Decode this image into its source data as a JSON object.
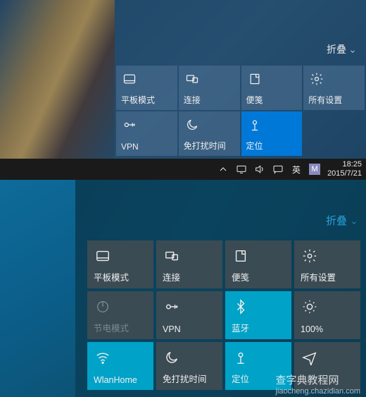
{
  "top": {
    "collapse_label": "折叠",
    "tiles": [
      {
        "name": "tablet-mode",
        "label": "平板模式",
        "icon": "tablet",
        "active": false
      },
      {
        "name": "connect",
        "label": "连接",
        "icon": "connect",
        "active": false
      },
      {
        "name": "note",
        "label": "便笺",
        "icon": "note",
        "active": false
      },
      {
        "name": "all-settings",
        "label": "所有设置",
        "icon": "gear",
        "active": false
      },
      {
        "name": "vpn",
        "label": "VPN",
        "icon": "vpn",
        "active": false
      },
      {
        "name": "quiet-hours",
        "label": "免打扰时间",
        "icon": "moon",
        "active": false
      },
      {
        "name": "location",
        "label": "定位",
        "icon": "location",
        "active": true
      }
    ],
    "taskbar": {
      "ime_text": "英",
      "ime_box": "M",
      "time": "18:25",
      "date": "2015/7/21"
    }
  },
  "bottom": {
    "collapse_label": "折叠",
    "tiles": [
      {
        "name": "tablet-mode",
        "label": "平板模式",
        "icon": "tablet",
        "active": false,
        "disabled": false
      },
      {
        "name": "connect",
        "label": "连接",
        "icon": "connect",
        "active": false,
        "disabled": false
      },
      {
        "name": "note",
        "label": "便笺",
        "icon": "note",
        "active": false,
        "disabled": false
      },
      {
        "name": "all-settings",
        "label": "所有设置",
        "icon": "gear",
        "active": false,
        "disabled": false
      },
      {
        "name": "battery-saver",
        "label": "节电模式",
        "icon": "power",
        "active": false,
        "disabled": true
      },
      {
        "name": "vpn",
        "label": "VPN",
        "icon": "vpn",
        "active": false,
        "disabled": false
      },
      {
        "name": "bluetooth",
        "label": "蓝牙",
        "icon": "bluetooth",
        "active": true,
        "disabled": false
      },
      {
        "name": "brightness",
        "label": "100%",
        "icon": "sun",
        "active": false,
        "disabled": false
      },
      {
        "name": "wifi",
        "label": "WlanHome",
        "icon": "wifi",
        "active": true,
        "disabled": false
      },
      {
        "name": "quiet-hours",
        "label": "免打扰时间",
        "icon": "moon",
        "active": false,
        "disabled": false
      },
      {
        "name": "location",
        "label": "定位",
        "icon": "location",
        "active": true,
        "disabled": false
      },
      {
        "name": "airplane",
        "label": "",
        "icon": "plane",
        "active": false,
        "disabled": false
      }
    ]
  },
  "watermark": {
    "line1": "查字典教程网",
    "line2": "jiaocheng.chazidian.com"
  }
}
